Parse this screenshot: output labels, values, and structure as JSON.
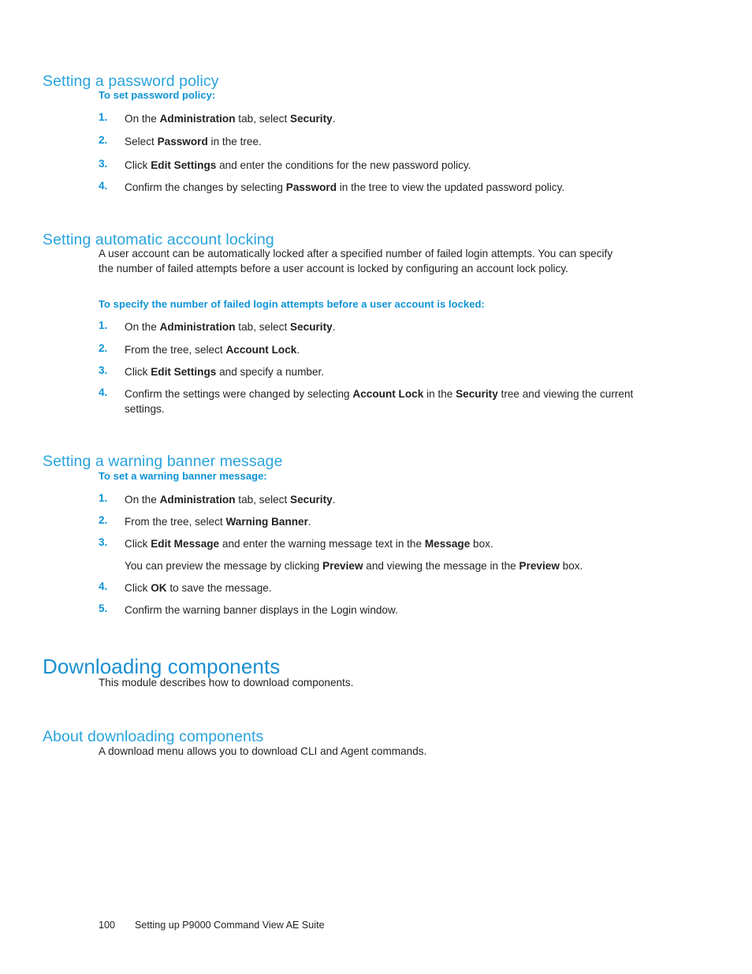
{
  "page": {
    "number": "100",
    "footer_title": "Setting up P9000 Command View AE Suite",
    "heading_color": "#29a3dd",
    "chapter_heading_color": "#1b8fd0",
    "subheading_color": "#0d93d6",
    "body_color": "#231f20",
    "background": "#ffffff"
  },
  "sections": {
    "password_policy": {
      "heading": "Setting a password policy",
      "subheading": "To set password policy:",
      "steps": [
        {
          "num": "1.",
          "text_1": "On the ",
          "bold_1": "Administration",
          "text_2": " tab, select ",
          "bold_2": "Security",
          "text_3": "."
        },
        {
          "num": "2.",
          "text_1": "Select ",
          "bold_1": "Password",
          "text_2": " in the tree.",
          "bold_2": "",
          "text_3": ""
        },
        {
          "num": "3.",
          "text_1": "Click ",
          "bold_1": "Edit Settings",
          "text_2": " and enter the conditions for the new password policy.",
          "bold_2": "",
          "text_3": ""
        },
        {
          "num": "4.",
          "text_1": "Confirm the changes by selecting ",
          "bold_1": "Password",
          "text_2": " in the tree to view the updated password policy.",
          "bold_2": "",
          "text_3": ""
        }
      ]
    },
    "account_locking": {
      "heading": "Setting automatic account locking",
      "intro": "A user account can be automatically locked after a specified number of failed login attempts. You can specify the number of failed attempts before a user account is locked by configuring an account lock policy.",
      "subheading": "To specify the number of failed login attempts before a user account is locked:",
      "steps": [
        {
          "num": "1.",
          "text_1": "On the ",
          "bold_1": "Administration",
          "text_2": " tab, select ",
          "bold_2": "Security",
          "text_3": "."
        },
        {
          "num": "2.",
          "text_1": "From the tree, select ",
          "bold_1": "Account Lock",
          "text_2": ".",
          "bold_2": "",
          "text_3": ""
        },
        {
          "num": "3.",
          "text_1": "Click ",
          "bold_1": "Edit Settings",
          "text_2": " and specify a number.",
          "bold_2": "",
          "text_3": ""
        },
        {
          "num": "4.",
          "text_1": "Confirm the settings were changed by selecting ",
          "bold_1": "Account Lock",
          "text_2": " in the ",
          "bold_2": "Security",
          "text_3": " tree and viewing the current settings."
        }
      ]
    },
    "warning_banner": {
      "heading": "Setting a warning banner message",
      "subheading": "To set a warning banner message:",
      "steps": [
        {
          "num": "1.",
          "text_1": "On the ",
          "bold_1": "Administration",
          "text_2": " tab, select ",
          "bold_2": "Security",
          "text_3": "."
        },
        {
          "num": "2.",
          "text_1": "From the tree, select ",
          "bold_1": "Warning Banner",
          "text_2": ".",
          "bold_2": "",
          "text_3": ""
        },
        {
          "num": "3.",
          "text_1": "Click ",
          "bold_1": "Edit Message",
          "text_2": " and enter the warning message text in the ",
          "bold_2": "Message",
          "text_3": " box."
        },
        {
          "num": "4.",
          "text_1": "Click ",
          "bold_1": "OK",
          "text_2": " to save the message.",
          "bold_2": "",
          "text_3": ""
        },
        {
          "num": "5.",
          "text_1": "Confirm the warning banner displays in the Login window.",
          "bold_1": "",
          "text_2": "",
          "bold_2": "",
          "text_3": ""
        }
      ],
      "step3_note": {
        "text_1": "You can preview the message by clicking ",
        "bold_1": "Preview",
        "text_2": " and viewing the message in the ",
        "bold_2": "Preview",
        "text_3": " box."
      }
    },
    "downloading_components": {
      "heading": "Downloading components",
      "intro": "This module describes how to download components."
    },
    "about_downloading": {
      "heading": "About downloading components",
      "intro": "A download menu allows you to download CLI and Agent commands."
    }
  }
}
